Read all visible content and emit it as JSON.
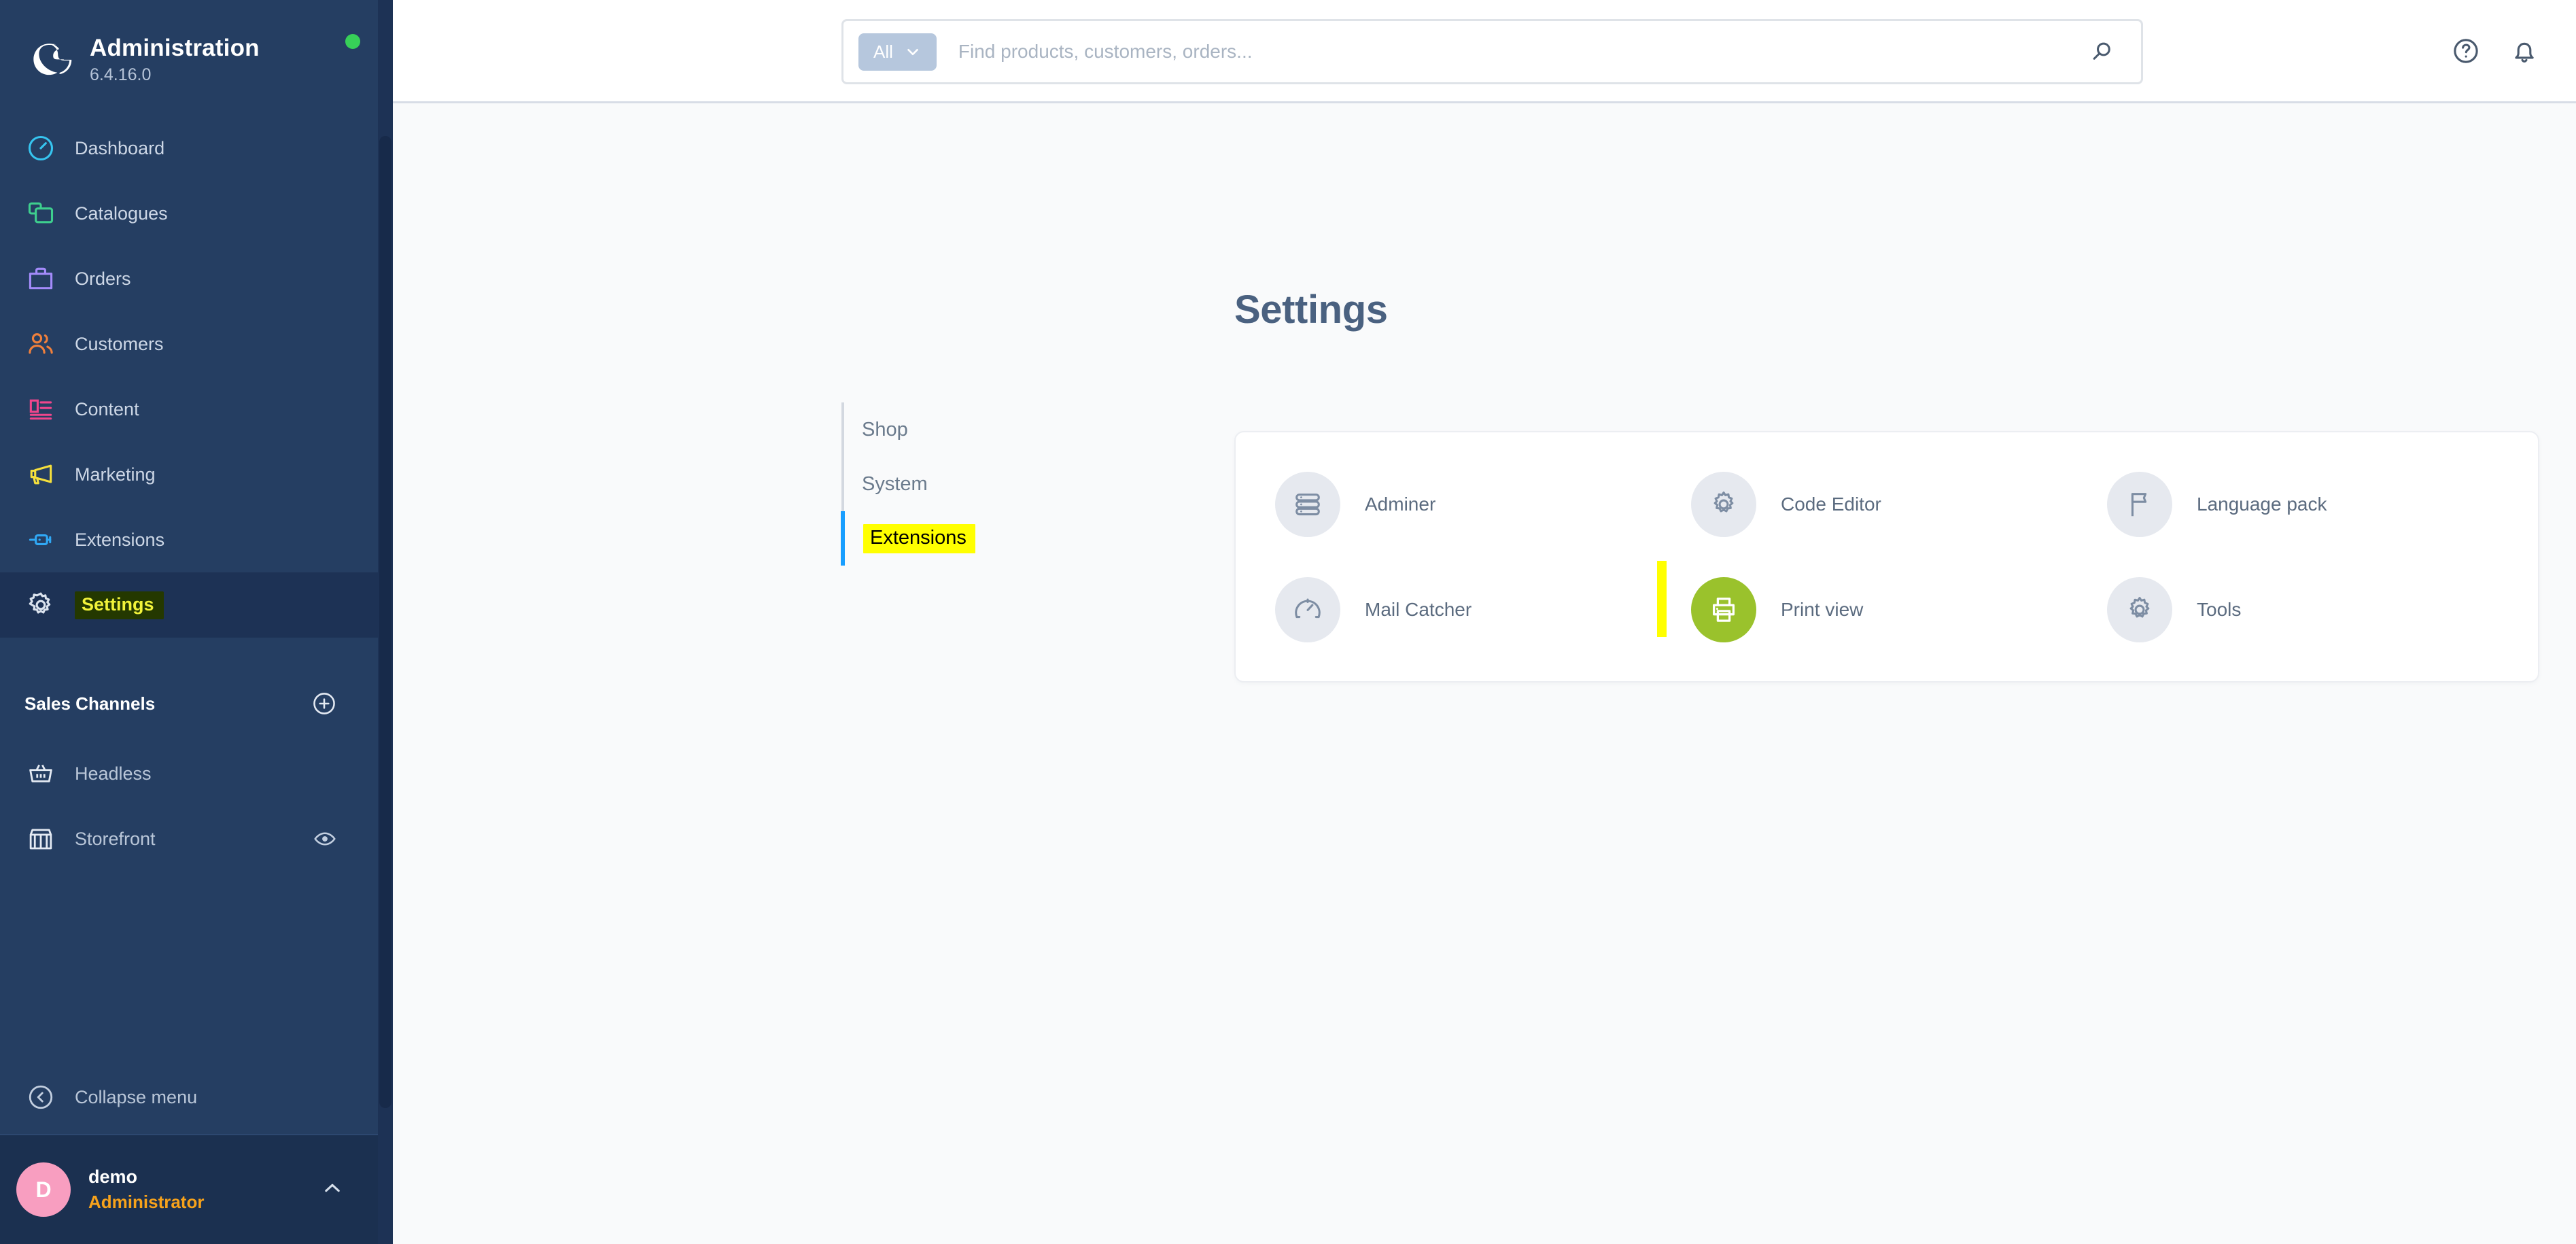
{
  "sidebar": {
    "brand": {
      "title": "Administration",
      "version": "6.4.16.0",
      "status_icon": "green-status-dot",
      "logo_icon": "shopware-logo"
    },
    "nav_items": [
      {
        "label": "Dashboard",
        "icon": "dashboard-gauge-icon",
        "color": "#36c5f0",
        "active": false
      },
      {
        "label": "Catalogues",
        "icon": "catalogues-layers-icon",
        "color": "#3ecf8e",
        "active": false
      },
      {
        "label": "Orders",
        "icon": "orders-bag-icon",
        "color": "#a48bfa",
        "active": false
      },
      {
        "label": "Customers",
        "icon": "customers-people-icon",
        "color": "#f0803c",
        "active": false
      },
      {
        "label": "Content",
        "icon": "content-list-icon",
        "color": "#f0468c",
        "active": false
      },
      {
        "label": "Marketing",
        "icon": "marketing-megaphone-icon",
        "color": "#f6e03c",
        "active": false
      },
      {
        "label": "Extensions",
        "icon": "extensions-plug-icon",
        "color": "#30a8f5",
        "active": false
      },
      {
        "label": "Settings",
        "icon": "settings-gear-icon",
        "color": "#dbe3ee",
        "active": true
      }
    ],
    "sales_channels": {
      "heading": "Sales Channels",
      "add_icon": "plus-circle-icon",
      "items": [
        {
          "label": "Headless",
          "icon": "basket-icon",
          "trailing_icon": ""
        },
        {
          "label": "Storefront",
          "icon": "storefront-icon",
          "trailing_icon": "eye-icon"
        }
      ]
    },
    "collapse": {
      "label": "Collapse menu",
      "icon": "collapse-left-circle-icon"
    },
    "user": {
      "initial": "D",
      "name": "demo",
      "role": "Administrator",
      "chevron_icon": "chevron-up-icon"
    }
  },
  "topbar": {
    "search": {
      "scope_label": "All",
      "scope_chevron_icon": "chevron-down-icon",
      "placeholder": "Find products, customers, orders...",
      "value": "",
      "submit_icon": "search-icon"
    },
    "actions": [
      {
        "name": "help-icon",
        "icon": "question-circle-icon"
      },
      {
        "name": "notifications-icon",
        "icon": "bell-icon"
      }
    ]
  },
  "page": {
    "title": "Settings",
    "tabs": [
      {
        "label": "Shop",
        "active": false
      },
      {
        "label": "System",
        "active": false
      },
      {
        "label": "Extensions",
        "active": true
      }
    ],
    "modules": [
      {
        "label": "Adminer",
        "icon": "database-stack-icon",
        "highlighted": false
      },
      {
        "label": "Code Editor",
        "icon": "gear-icon",
        "highlighted": false
      },
      {
        "label": "Language pack",
        "icon": "flag-icon",
        "highlighted": false
      },
      {
        "label": "Mail Catcher",
        "icon": "gauge-icon",
        "highlighted": false
      },
      {
        "label": "Print view",
        "icon": "printer-icon",
        "highlighted": true
      },
      {
        "label": "Tools",
        "icon": "gear-icon",
        "highlighted": false
      }
    ]
  },
  "colors": {
    "sidebar_bg": "#253e62",
    "sidebar_active_bg": "#1d3255",
    "accent_blue": "#189eff",
    "highlight_yellow": "#ffff00",
    "status_green": "#37d058",
    "avatar_pink": "#f89ec0",
    "role_orange": "#f7a21b",
    "module_highlight_green": "#9ac22c"
  }
}
